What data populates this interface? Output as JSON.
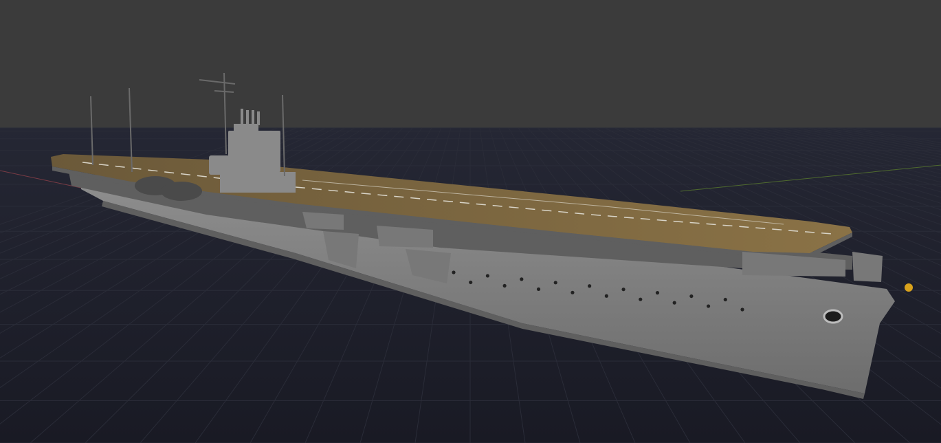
{
  "viewport": {
    "kind": "3d-viewport",
    "background_color": "#3b3b3b",
    "grid_color": "#2a2c38",
    "grid_axis_x_color": "#7a3b45",
    "grid_axis_y_color": "#4f6a2e"
  },
  "model": {
    "subject": "aircraft-carrier",
    "hull_color": "#828282",
    "hull_shadow_color": "#5f5f5f",
    "flight_deck_color": "#7a6540",
    "deck_marking_color": "#d8d4c8",
    "island_color": "#8a8a8a",
    "mast_color": "#6a6a6a",
    "bow_emblem_color": "#d9a21c"
  },
  "icons": {
    "grid-floor": "grid-floor-icon",
    "ship": "carrier-model-icon"
  }
}
